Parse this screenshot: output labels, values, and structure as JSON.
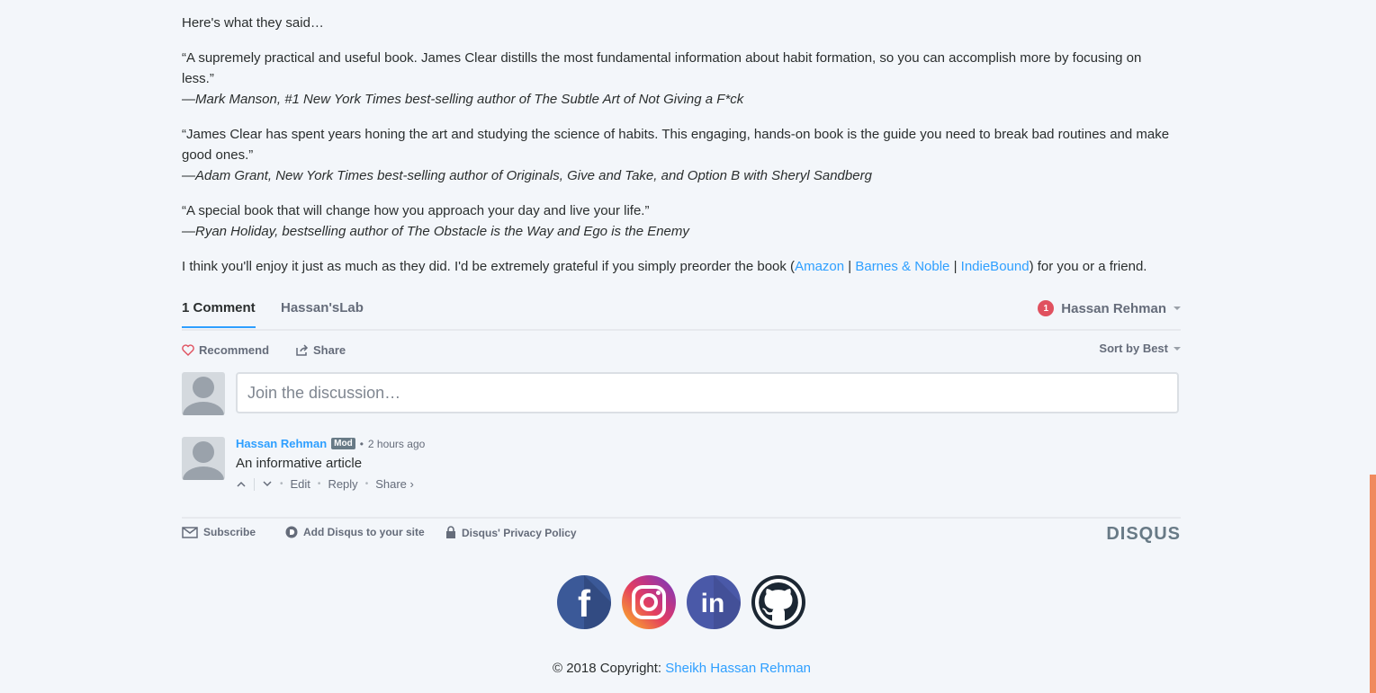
{
  "article": {
    "intro": "Here's what they said…",
    "quotes": [
      {
        "text": "“A supremely practical and useful book. James Clear distills the most fundamental information about habit formation, so you can accomplish more by focusing on less.”",
        "attribution": "—Mark Manson, #1 New York Times best-selling author of The Subtle Art of Not Giving a F*ck"
      },
      {
        "text": "“James Clear has spent years honing the art and studying the science of habits. This engaging, hands-on book is the guide you need to break bad routines and make good ones.”",
        "attribution": "—Adam Grant, New York Times best-selling author of Originals, Give and Take, and Option B with Sheryl Sandberg"
      },
      {
        "text": "“A special book that will change how you approach your day and live your life.”",
        "attribution": "—Ryan Holiday, bestselling author of The Obstacle is the Way and Ego is the Enemy"
      }
    ],
    "closing_before": "I think you'll enjoy it just as much as they did. I'd be extremely grateful if you simply preorder the book (",
    "links": [
      "Amazon",
      "Barnes & Noble",
      "IndieBound"
    ],
    "link_separator": "|",
    "closing_after": ") for you or a friend."
  },
  "disqus": {
    "tabs": {
      "comments": "1 Comment",
      "community": "Hassan'sLab"
    },
    "user": {
      "notifications": "1",
      "name": "Hassan Rehman"
    },
    "actions": {
      "recommend": "Recommend",
      "share": "Share",
      "sort": "Sort by Best"
    },
    "compose": {
      "placeholder": "Join the discussion…"
    },
    "comment": {
      "author": "Hassan Rehman",
      "badge": "Mod",
      "bullet": "•",
      "time": "2 hours ago",
      "text": "An informative article",
      "edit": "Edit",
      "reply": "Reply",
      "share": "Share ›",
      "dot": "•"
    },
    "footer": {
      "subscribe": "Subscribe",
      "add": "Add Disqus to your site",
      "privacy": "Disqus' Privacy Policy",
      "brand": "DISQUS"
    }
  },
  "social": {
    "icons": [
      "facebook-icon",
      "instagram-icon",
      "linkedin-icon",
      "github-icon"
    ],
    "labels": {
      "facebook": "f",
      "linkedin": "in"
    }
  },
  "footer": {
    "copyright": "© 2018 Copyright: ",
    "owner": "Sheikh Hassan Rehman"
  },
  "colors": {
    "link": "#2e9fff",
    "accent": "#f08a5d",
    "notif": "#e0515f"
  }
}
